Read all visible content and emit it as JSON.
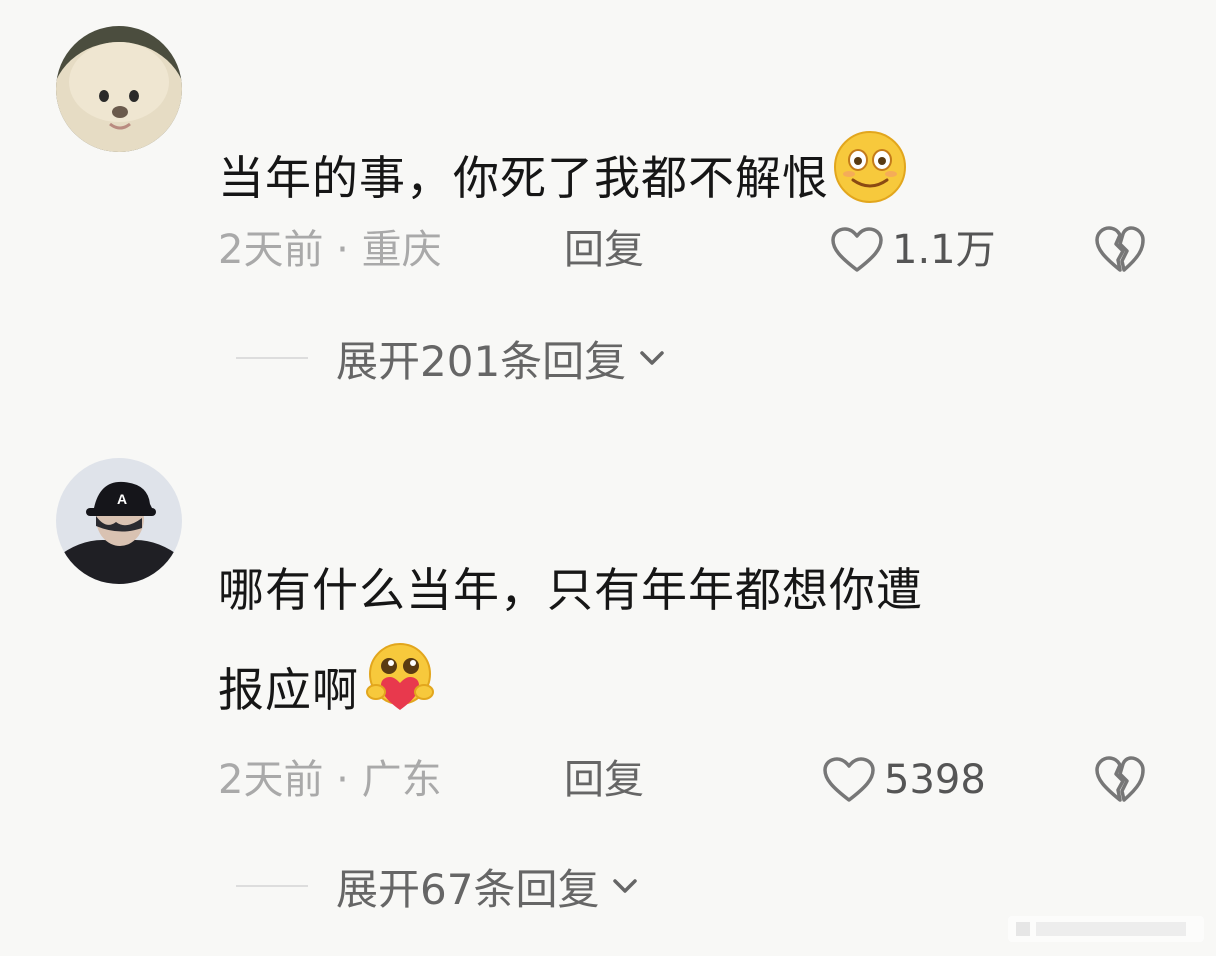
{
  "comments": [
    {
      "text": "当年的事，你死了我都不解恨",
      "emoji": "smile-emoji",
      "time": "2天前",
      "location": "重庆",
      "reply_label": "回复",
      "likes": "1.1万",
      "expand_label": "展开201条回复"
    },
    {
      "text_line1": "哪有什么当年，只有年年都想你遭",
      "text_line2": "报应啊",
      "emoji": "heart-hug-emoji",
      "time": "2天前",
      "location": "广东",
      "reply_label": "回复",
      "likes": "5398",
      "expand_label": "展开67条回复"
    }
  ],
  "separator": "·",
  "colors": {
    "background": "#f8f8f6",
    "meta": "#a9a9a9",
    "action": "#666666",
    "text": "#161616"
  },
  "icons": [
    "heart-outline-icon",
    "broken-heart-icon",
    "chevron-down-icon"
  ]
}
